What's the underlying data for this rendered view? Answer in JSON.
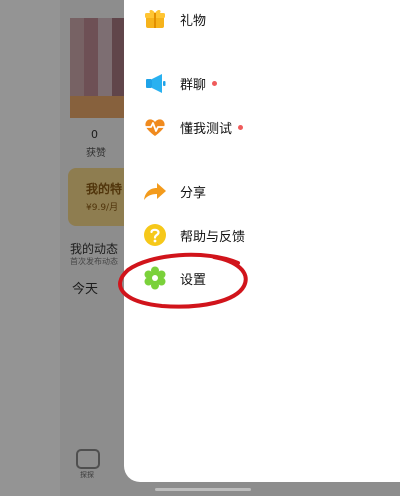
{
  "background_page": {
    "stat": {
      "count": "0",
      "label": "获赞"
    },
    "vip": {
      "title": "我的特",
      "price": "¥9.9/月"
    },
    "dynamics": {
      "title": "我的动态",
      "subtitle": "首次发布动态",
      "today": "今天"
    },
    "bottom_nav": {
      "label": "探探"
    }
  },
  "drawer": {
    "items": [
      {
        "label": "礼物",
        "icon": "gift-icon",
        "dot": false
      },
      {
        "label": "群聊",
        "icon": "megaphone-icon",
        "dot": true
      },
      {
        "label": "懂我测试",
        "icon": "heartbeat-icon",
        "dot": true
      },
      {
        "label": "分享",
        "icon": "share-arrow-icon",
        "dot": false
      },
      {
        "label": "帮助与反馈",
        "icon": "help-icon",
        "dot": false
      },
      {
        "label": "设置",
        "icon": "settings-gear-icon",
        "dot": false
      }
    ],
    "dot_color": "#ef5b5b",
    "accent_colors": {
      "gift": "#f6b31b",
      "megaphone": "#1fa3e8",
      "heartbeat": "#f08a1e",
      "share": "#f39b1c",
      "help": "#f6c81a",
      "settings": "#7ad13a"
    }
  },
  "annotation": {
    "color": "#d1141b",
    "target": "设置"
  }
}
